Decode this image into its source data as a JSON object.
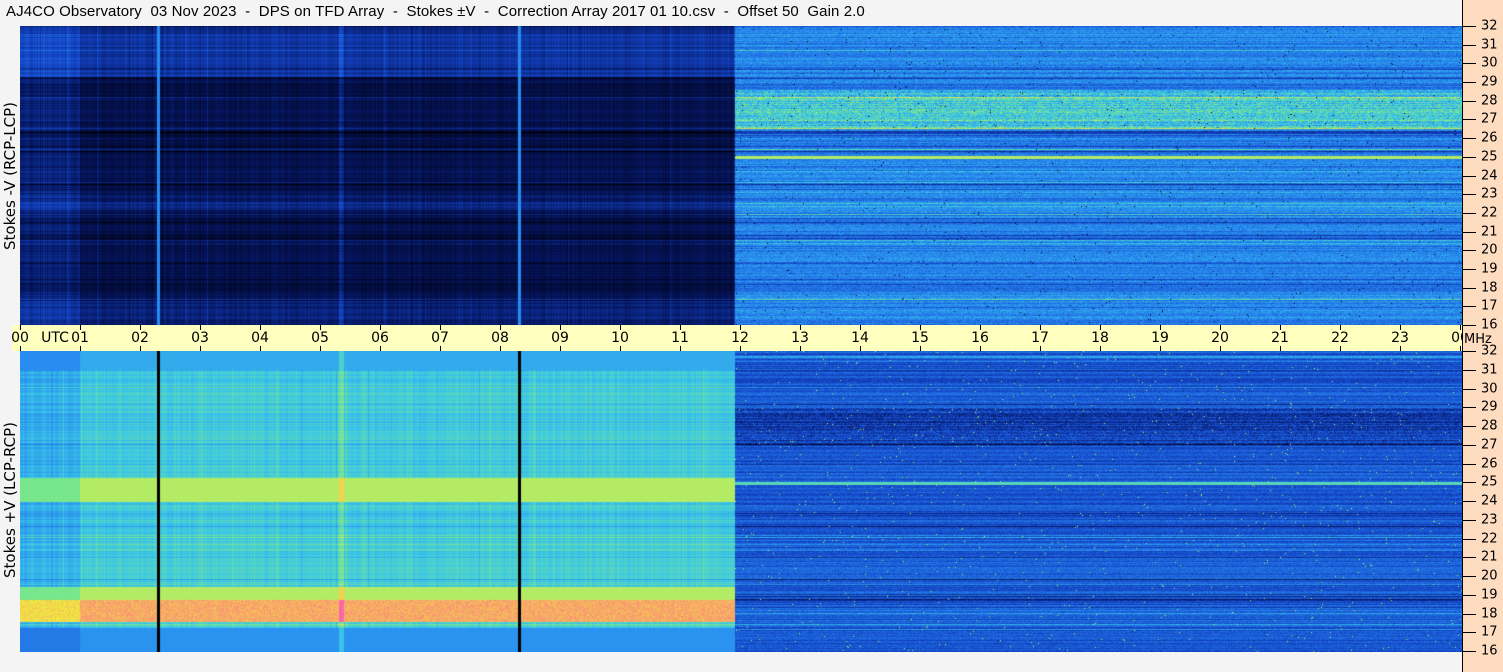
{
  "title": "AJ4CO Observatory  03 Nov 2023  -  DPS on TFD Array  -  Stokes ±V  -  Correction Array 2017 01 10.csv  -  Offset 50  Gain 2.0",
  "chart_data": [
    {
      "type": "heatmap",
      "ylabel": "Stokes -V (RCP-LCP)",
      "x_ticks": [
        "00",
        "01",
        "02",
        "03",
        "04",
        "05",
        "06",
        "07",
        "08",
        "09",
        "10",
        "11",
        "12",
        "13",
        "14",
        "15",
        "16",
        "17",
        "18",
        "19",
        "20",
        "21",
        "22",
        "23",
        "00"
      ],
      "y_ticks": [
        "32",
        "31",
        "30",
        "29",
        "28",
        "27",
        "26",
        "25",
        "24",
        "23",
        "22",
        "21",
        "20",
        "19",
        "18",
        "17",
        "16"
      ],
      "ylim": [
        16,
        32
      ],
      "xlim_hours_utc": [
        0,
        24
      ]
    },
    {
      "type": "heatmap",
      "ylabel": "Stokes +V (LCP-RCP)",
      "x_ticks": [
        "00",
        "01",
        "02",
        "03",
        "04",
        "05",
        "06",
        "07",
        "08",
        "09",
        "10",
        "11",
        "12",
        "13",
        "14",
        "15",
        "16",
        "17",
        "18",
        "19",
        "20",
        "21",
        "22",
        "23",
        "00"
      ],
      "y_ticks": [
        "32",
        "31",
        "30",
        "29",
        "28",
        "27",
        "26",
        "25",
        "24",
        "23",
        "22",
        "21",
        "20",
        "19",
        "18",
        "17",
        "16"
      ],
      "ylim": [
        16,
        32
      ],
      "xlim_hours_utc": [
        0,
        24
      ]
    }
  ],
  "time_axis": {
    "utc_label": "UTC",
    "unit_label": "MHz"
  }
}
